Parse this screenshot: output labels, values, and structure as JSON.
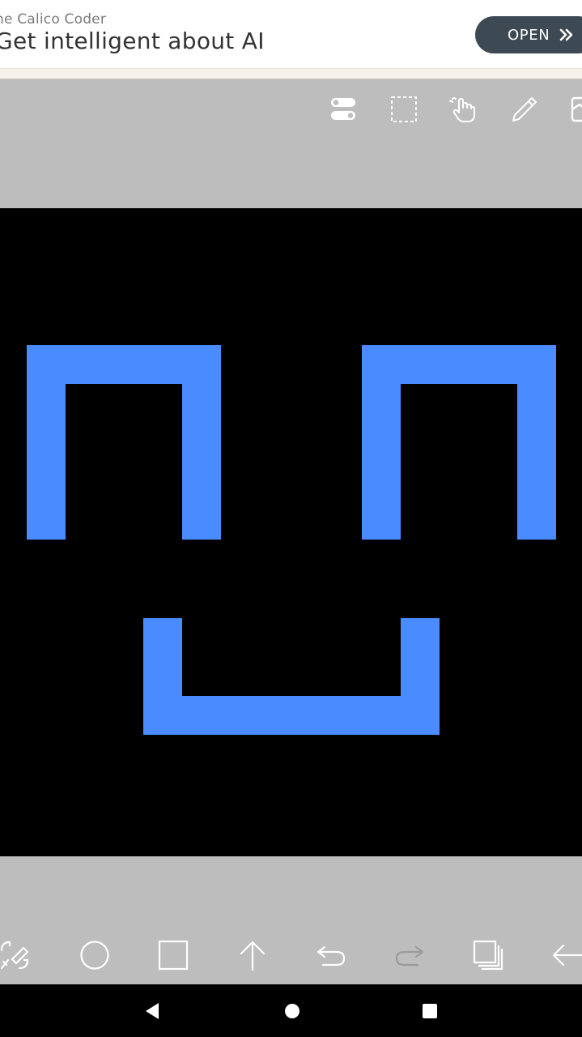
{
  "ad": {
    "sponsor": "he Calico Coder",
    "headline": "Get intelligent about AI",
    "open_label": "OPEN"
  },
  "colors": {
    "shape_fill": "#4a8cff",
    "canvas_bg": "#000000",
    "toolbar_bg": "#bdbdbd",
    "icon_color": "#ffffff",
    "ad_button_bg": "#3e4a53"
  },
  "top_toolbar": {
    "icons": [
      "toggle-settings-icon",
      "select-rect-icon",
      "touch-hand-icon",
      "pencil-icon",
      "image-icon"
    ]
  },
  "canvas": {
    "shapes": [
      {
        "name": "left-eye-shape",
        "type": "path"
      },
      {
        "name": "right-eye-shape",
        "type": "path"
      },
      {
        "name": "mouth-shape",
        "type": "path"
      }
    ]
  },
  "bottom_toolbar": {
    "icons": [
      "transform-icon",
      "circle-tool-icon",
      "rectangle-tool-icon",
      "arrow-up-icon",
      "undo-icon",
      "redo-icon",
      "layers-icon",
      "back-arrow-icon"
    ]
  },
  "nav": {
    "buttons": [
      "nav-back-button",
      "nav-home-button",
      "nav-recents-button"
    ]
  }
}
